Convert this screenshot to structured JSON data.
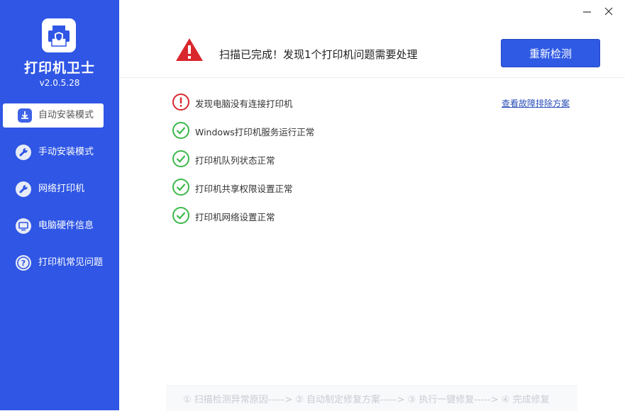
{
  "app": {
    "title": "打印机卫士",
    "version": "v2.0.5.28"
  },
  "sidebar": {
    "items": [
      {
        "label": "自动安装模式",
        "icon": "download-icon",
        "active": true
      },
      {
        "label": "手动安装模式",
        "icon": "wrench-icon",
        "active": false
      },
      {
        "label": "网络打印机",
        "icon": "wrench-icon",
        "active": false
      },
      {
        "label": "电脑硬件信息",
        "icon": "monitor-icon",
        "active": false
      },
      {
        "label": "打印机常见问题",
        "icon": "question-icon",
        "active": false
      }
    ]
  },
  "window": {
    "minimize_icon": "minimize-icon",
    "close_icon": "close-icon"
  },
  "header": {
    "message": "扫描已完成！发现1个打印机问题需要处理",
    "rescan_label": "重新检测"
  },
  "results": {
    "items": [
      {
        "text": "发现电脑没有连接打印机",
        "status": "error"
      },
      {
        "text": "Windows打印机服务运行正常",
        "status": "ok"
      },
      {
        "text": "打印机队列状态正常",
        "status": "ok"
      },
      {
        "text": "打印机共享权限设置正常",
        "status": "ok"
      },
      {
        "text": "打印机网络设置正常",
        "status": "ok"
      }
    ],
    "troubleshoot_link": "查看故障排除方案"
  },
  "steps": {
    "text": "① 扫描检测异常原因-----> ② 自动制定修复方案-----> ③ 执行一键修复-----> ④ 完成修复"
  },
  "colors": {
    "sidebar_bg": "#2f56e4",
    "accent": "#2f5ae4",
    "error": "#d9272e",
    "ok": "#3cb84a",
    "link": "#2a4fb8"
  }
}
